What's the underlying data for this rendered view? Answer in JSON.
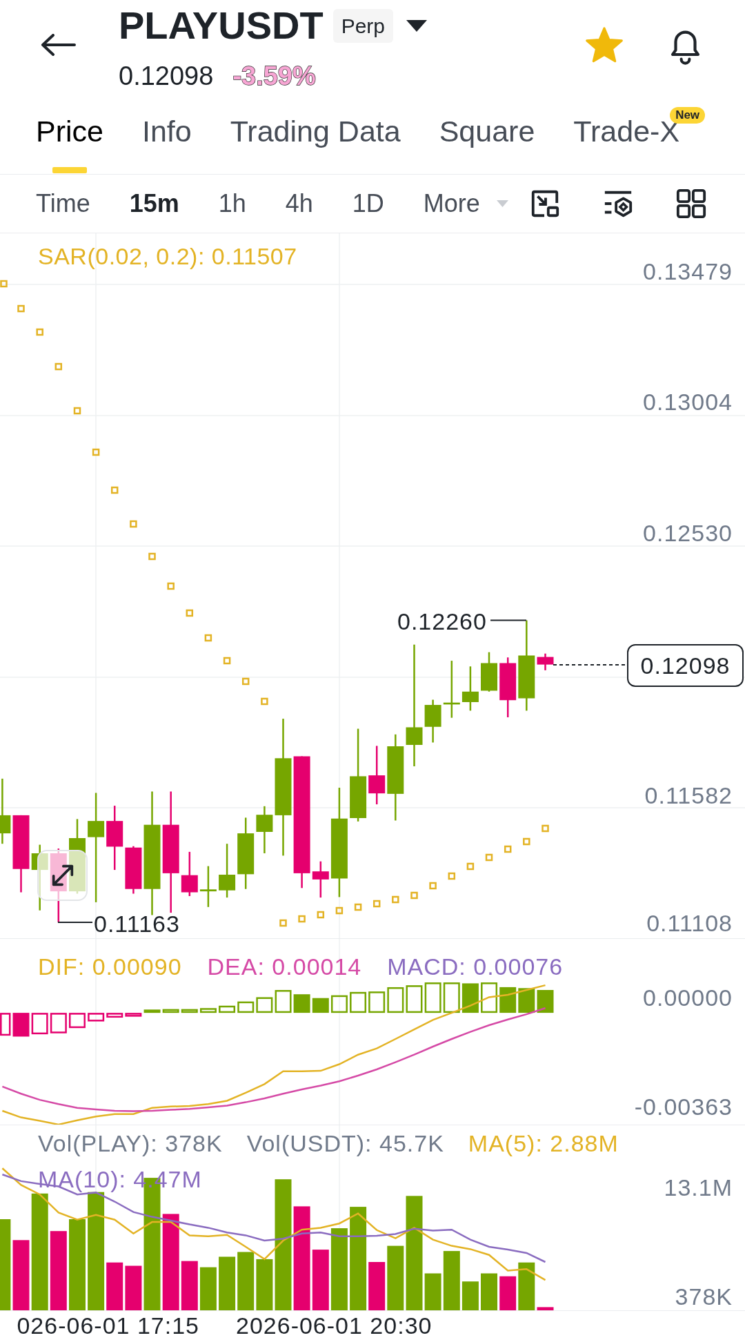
{
  "header": {
    "symbol": "PLAYUSDT",
    "contract_badge": "Perp",
    "last_price": "0.12098",
    "change": "-3.59%",
    "favorite": true
  },
  "tabs": [
    {
      "label": "Price",
      "selected": true
    },
    {
      "label": "Info",
      "selected": false
    },
    {
      "label": "Trading Data",
      "selected": false
    },
    {
      "label": "Square",
      "selected": false
    },
    {
      "label": "Trade-X",
      "selected": false,
      "badge": "New"
    }
  ],
  "intervals": [
    {
      "label": "Time",
      "kind": "option",
      "selected": false
    },
    {
      "label": "15m",
      "kind": "option",
      "selected": true
    },
    {
      "label": "1h",
      "kind": "option",
      "selected": false
    },
    {
      "label": "4h",
      "kind": "option",
      "selected": false
    },
    {
      "label": "1D",
      "kind": "option",
      "selected": false
    },
    {
      "label": "More",
      "kind": "dropdown",
      "selected": false
    }
  ],
  "price_chart": {
    "indicator_label": "SAR(0.02, 0.2): 0.11507",
    "axis_labels": [
      "0.13479",
      "0.13004",
      "0.12530",
      "0.11582",
      "0.11108"
    ],
    "high_label": "0.12260",
    "low_label": "0.11163",
    "current_price": "0.12098"
  },
  "macd_chart": {
    "legend": [
      {
        "text": "DIF: 0.00090",
        "color": "#e3b325"
      },
      {
        "text": "DEA: 0.00014",
        "color": "#d54aa6"
      },
      {
        "text": "MACD: 0.00076",
        "color": "#8a6cc0"
      }
    ],
    "axis_labels": [
      "0.00000",
      "-0.00363"
    ]
  },
  "volume_chart": {
    "legend": [
      {
        "text": "Vol(PLAY): 378K",
        "color": "#707a8a"
      },
      {
        "text": "Vol(USDT): 45.7K",
        "color": "#707a8a"
      },
      {
        "text": "MA(5): 2.88M",
        "color": "#e3b325"
      },
      {
        "text": "MA(10): 4.47M",
        "color": "#8a6cc0"
      }
    ],
    "axis_labels": [
      "13.1M",
      "378K"
    ]
  },
  "time_axis": [
    "026-06-01 17:15",
    "2026-06-01 20:30"
  ]
}
